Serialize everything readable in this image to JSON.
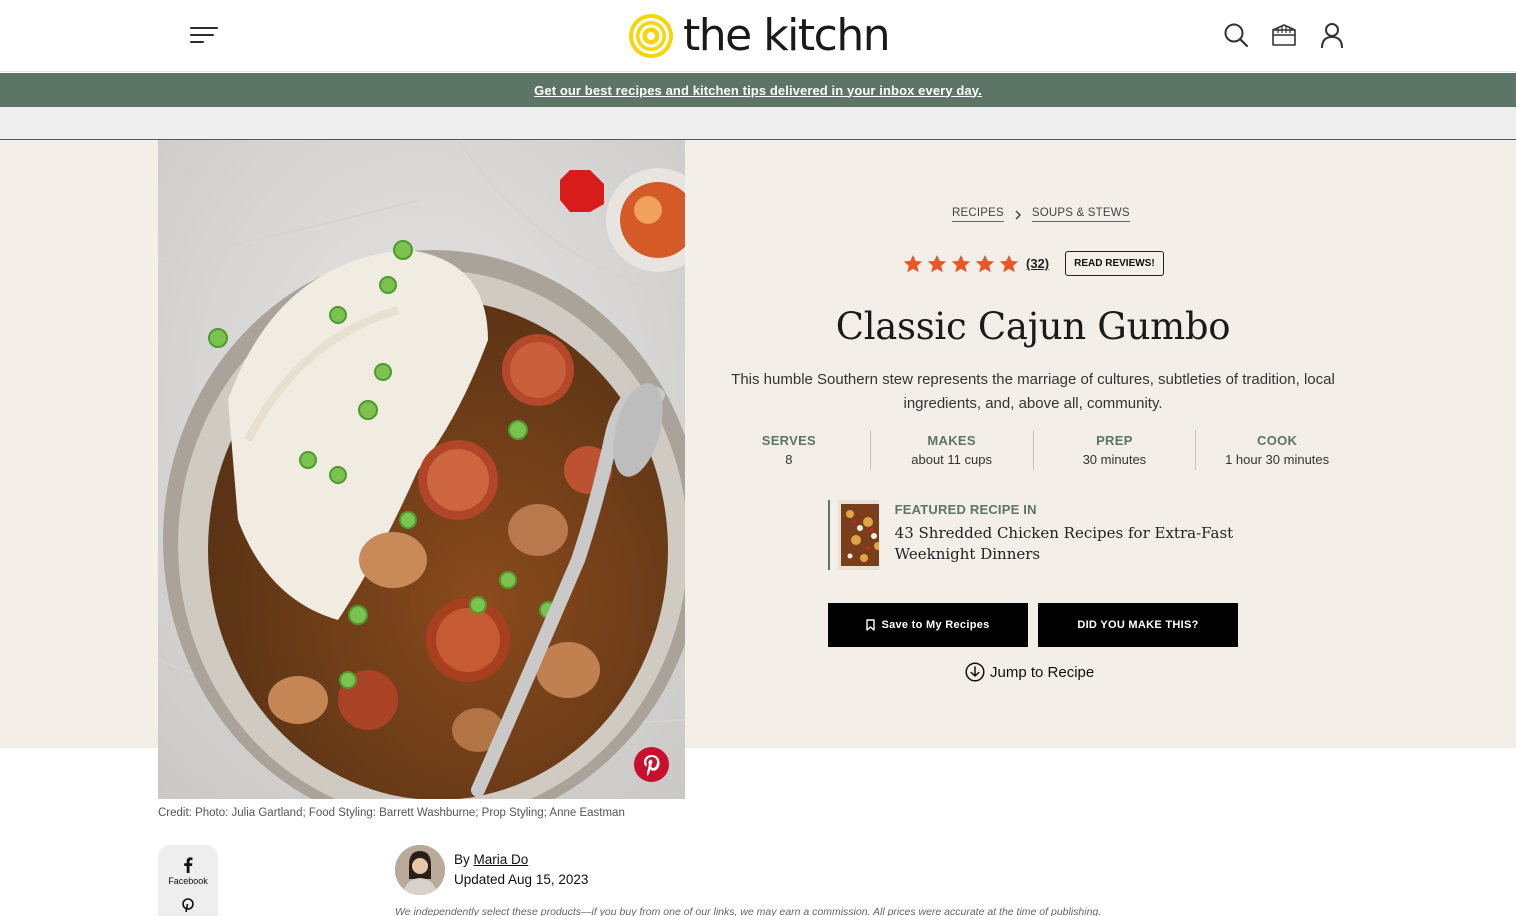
{
  "header": {
    "logo_text": "the kitchn",
    "icons": [
      "menu-icon",
      "search-icon",
      "recipe-box-icon",
      "user-icon"
    ]
  },
  "promo": {
    "text": "Get our best recipes and kitchen tips delivered in your inbox every day."
  },
  "breadcrumb": [
    "RECIPES",
    "SOUPS & STEWS"
  ],
  "rating": {
    "stars": 5,
    "count_text": "(32)",
    "read_reviews_label": "READ REVIEWS!"
  },
  "recipe": {
    "title": "Classic Cajun Gumbo",
    "description": "This humble Southern stew represents the marriage of cultures, subtleties of tradition, local ingredients, and, above all, community.",
    "stats": [
      {
        "label": "SERVES",
        "value": "8"
      },
      {
        "label": "MAKES",
        "value": "about 11 cups"
      },
      {
        "label": "PREP",
        "value": "30 minutes"
      },
      {
        "label": "COOK",
        "value": "1 hour 30 minutes"
      }
    ]
  },
  "featured": {
    "label": "FEATURED RECIPE IN",
    "link": "43 Shredded Chicken Recipes for Extra-Fast Weeknight Dinners"
  },
  "actions": {
    "save_label": "Save to My Recipes",
    "made_label": "DID YOU MAKE THIS?",
    "jump_label": "Jump to Recipe"
  },
  "photo": {
    "credit": "Credit: Photo: Julia Gartland; Food Styling: Barrett Washburne; Prop Styling; Anne Eastman"
  },
  "share": {
    "facebook_label": "Facebook"
  },
  "byline": {
    "by": "By",
    "author": "Maria Do",
    "updated": "Updated Aug 15, 2023"
  },
  "disclaimer": "We independently select these products—if you buy from one of our links, we may earn a commission. All prices were accurate at the time of publishing.",
  "colors": {
    "accent_green": "#5c7566",
    "hero_bg": "#f3efe8",
    "star_color": "#e8562a",
    "logo_yellow": "#f5d60a",
    "pinterest_red": "#c8102e"
  }
}
